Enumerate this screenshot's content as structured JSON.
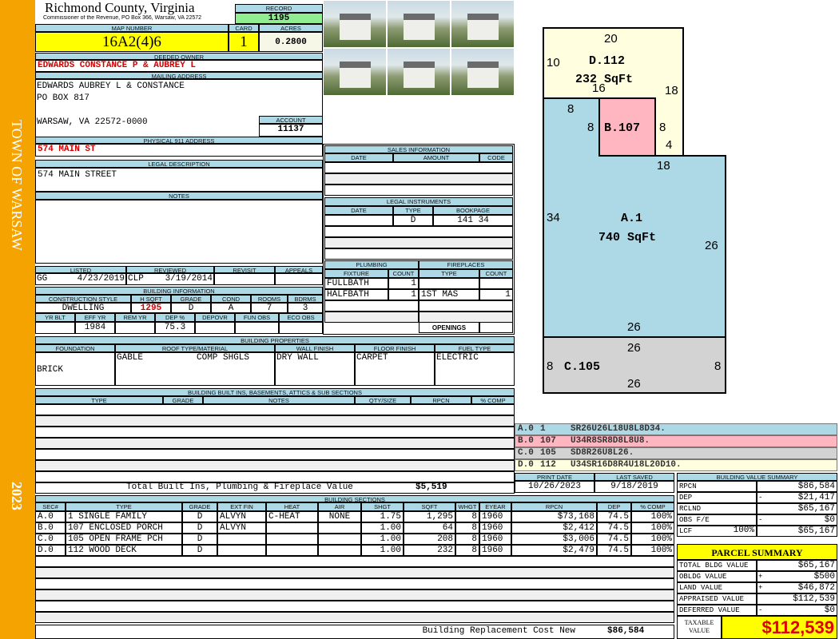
{
  "sidebar": {
    "town": "TOWN OF WARSAW",
    "year": "2023"
  },
  "header": {
    "title": "Richmond County, Virginia",
    "subtitle": "Commissioner of the Revenue, PO Box 366, Warsaw, VA 22572",
    "record_label": "RECORD",
    "record": "1195"
  },
  "parcel": {
    "map_label": "MAP NUMBER",
    "map_number": "16A2(4)6",
    "card_label": "CARD",
    "card": "1",
    "acres_label": "ACRES",
    "acres": "0.2800"
  },
  "owner": {
    "label": "DEEDED OWNER",
    "name": "EDWARDS CONSTANCE P & AUBREY L"
  },
  "mailing": {
    "label": "MAILING ADDRESS",
    "lines": [
      "EDWARDS AUBREY L & CONSTANCE",
      "PO BOX 817",
      "WARSAW, VA 22572-0000"
    ],
    "account_label": "ACCOUNT",
    "account": "11137"
  },
  "physical": {
    "label": "PHYSICAL 911 ADDRESS",
    "address": "574 MAIN ST"
  },
  "legal": {
    "label": "LEGAL DESCRIPTION",
    "text": "574 MAIN STREET"
  },
  "notes": {
    "label": "NOTES"
  },
  "review": {
    "headers": [
      "LISTED",
      "REVIEWED",
      "REVISIT",
      "APPEALS"
    ],
    "listed_by": "GG",
    "listed_date": "4/23/2019",
    "reviewed_by": "CLP",
    "reviewed_date": "3/19/2014"
  },
  "building_info": {
    "title": "BUILDING INFORMATION",
    "headers1": [
      "CONSTRUCTION STYLE",
      "H SQFT",
      "GRADE",
      "COND",
      "ROOMS",
      "BDRMS"
    ],
    "values1": [
      "DWELLING",
      "1295",
      "D",
      "A",
      "7",
      "3"
    ],
    "headers2": [
      "YR BLT",
      "EFF YR",
      "REM YR",
      "DEP %",
      "DEPOVR",
      "FUN OBS",
      "ECO OBS"
    ],
    "values2": [
      "",
      "1984",
      "",
      "75.3",
      "",
      "",
      ""
    ]
  },
  "properties": {
    "title": "BUILDING PROPERTIES",
    "headers": [
      "FOUNDATION",
      "ROOF TYPE/MATERIAL",
      "WALL FINISH",
      "FLOOR FINISH",
      "FUEL TYPE"
    ],
    "foundation": "BRICK",
    "roof_type": "GABLE",
    "roof_material": "COMP SHGLS",
    "wall": "DRY WALL",
    "floor": "CARPET",
    "fuel": "ELECTRIC"
  },
  "builtins": {
    "title": "BUILDING BUILT INS, BASEMENTS, ATTICS & SUB SECTIONS",
    "headers": [
      "TYPE",
      "GRADE",
      "NOTES",
      "QTY/SIZE",
      "RPCN",
      "% COMP"
    ],
    "total_label": "Total Built Ins, Plumbing & Fireplace Value",
    "total_value": "$5,519"
  },
  "sales": {
    "title": "SALES INFORMATION",
    "headers": [
      "DATE",
      "AMOUNT",
      "CODE"
    ]
  },
  "legal_instruments": {
    "title": "LEGAL INSTRUMENTS",
    "headers": [
      "DATE",
      "TYPE",
      "BOOKPAGE"
    ],
    "rows": [
      [
        "",
        "D",
        "141 34"
      ]
    ]
  },
  "plumbing": {
    "title": "PLUMBING",
    "headers": [
      "FIXTURE",
      "COUNT"
    ],
    "rows": [
      [
        "FULLBATH",
        "1"
      ],
      [
        "HALFBATH",
        "1"
      ]
    ]
  },
  "fireplaces": {
    "title": "FIREPLACES",
    "headers": [
      "TYPE",
      "COUNT"
    ],
    "rows": [
      [
        "",
        ""
      ],
      [
        "1ST MAS",
        "1"
      ]
    ],
    "openings_label": "OPENINGS"
  },
  "sketch": {
    "d_label": "D.112",
    "d_area": "232 SqFt",
    "a_label": "A.1",
    "a_area": "740 SqFt",
    "b_label": "B.107",
    "c_label": "C.105",
    "dims": {
      "d_top": "20",
      "d_left": "10",
      "d_right": "18",
      "d_inner": "16",
      "d_small": "4",
      "a_top": "8",
      "b_left": "8",
      "b_right": "8",
      "a_step": "18",
      "a_left": "34",
      "a_right": "26",
      "a_bottom": "26",
      "c_top": "26",
      "c_left": "8",
      "c_right": "8",
      "c_bottom": "26"
    },
    "colors": {
      "a": "#add8e6",
      "b": "#ffb6c1",
      "c": "#d3d3d3",
      "d": "#ffffe0"
    }
  },
  "sketch_legend": [
    [
      "A.0",
      "1",
      "SR26U26L18U8L8D34."
    ],
    [
      "B.0",
      "107",
      "U34R8SR8D8L8U8."
    ],
    [
      "C.0",
      "105",
      "SD8R26U8L26."
    ],
    [
      "D.0",
      "112",
      "U34SR16D8R4U18L20D10."
    ]
  ],
  "dates": {
    "print_label": "PRINT DATE",
    "print": "10/26/2023",
    "saved_label": "LAST SAVED",
    "saved": "9/18/2019"
  },
  "sections": {
    "title": "BUILDING SECTIONS",
    "headers": [
      "SEC#",
      "TYPE",
      "GRADE",
      "EXT FIN",
      "HEAT",
      "AIR",
      "SHGT",
      "SQFT",
      "WHGT",
      "EYEAR",
      "RPCN",
      "DEP",
      "% COMP"
    ],
    "rows": [
      [
        "A.0",
        "1 SINGLE FAMILY",
        "D",
        "ALVYN",
        "C-HEAT",
        "NONE",
        "1.75",
        "1,295",
        "8",
        "1960",
        "$73,168",
        "74.5",
        "100%"
      ],
      [
        "B.0",
        "107 ENCLOSED PORCH",
        "D",
        "ALVYN",
        "",
        "",
        "1.00",
        "64",
        "8",
        "1960",
        "$2,412",
        "74.5",
        "100%"
      ],
      [
        "C.0",
        "105 OPEN FRAME PCH",
        "D",
        "",
        "",
        "",
        "1.00",
        "208",
        "8",
        "1960",
        "$3,006",
        "74.5",
        "100%"
      ],
      [
        "D.0",
        "112 WOOD DECK",
        "D",
        "",
        "",
        "",
        "1.00",
        "232",
        "8",
        "1960",
        "$2,479",
        "74.5",
        "100%"
      ]
    ],
    "replacement_label": "Building Replacement Cost New",
    "replacement_value": "$86,584"
  },
  "value_summary": {
    "title": "BUILDING VALUE SUMMARY",
    "rows": [
      [
        "RPCN",
        "",
        "$86,584"
      ],
      [
        "DEP",
        "-",
        "$21,417"
      ],
      [
        "RCLND",
        "",
        "$65,167"
      ],
      [
        "OBS F/E",
        "-",
        "$0"
      ],
      [
        "LCF",
        "100%",
        "$65,167"
      ]
    ]
  },
  "parcel_summary": {
    "title": "PARCEL SUMMARY",
    "rows": [
      [
        "TOTAL BLDG VALUE",
        "",
        "$65,167"
      ],
      [
        "OBLDG VALUE",
        "+",
        "$500"
      ],
      [
        "LAND VALUE",
        "+",
        "$46,872"
      ],
      [
        "APPRAISED VALUE",
        "",
        "$112,539"
      ],
      [
        "DEFERRED VALUE",
        "-",
        "$0"
      ]
    ],
    "taxable_label": "TAXABLE VALUE",
    "taxable_value": "$112,539"
  }
}
